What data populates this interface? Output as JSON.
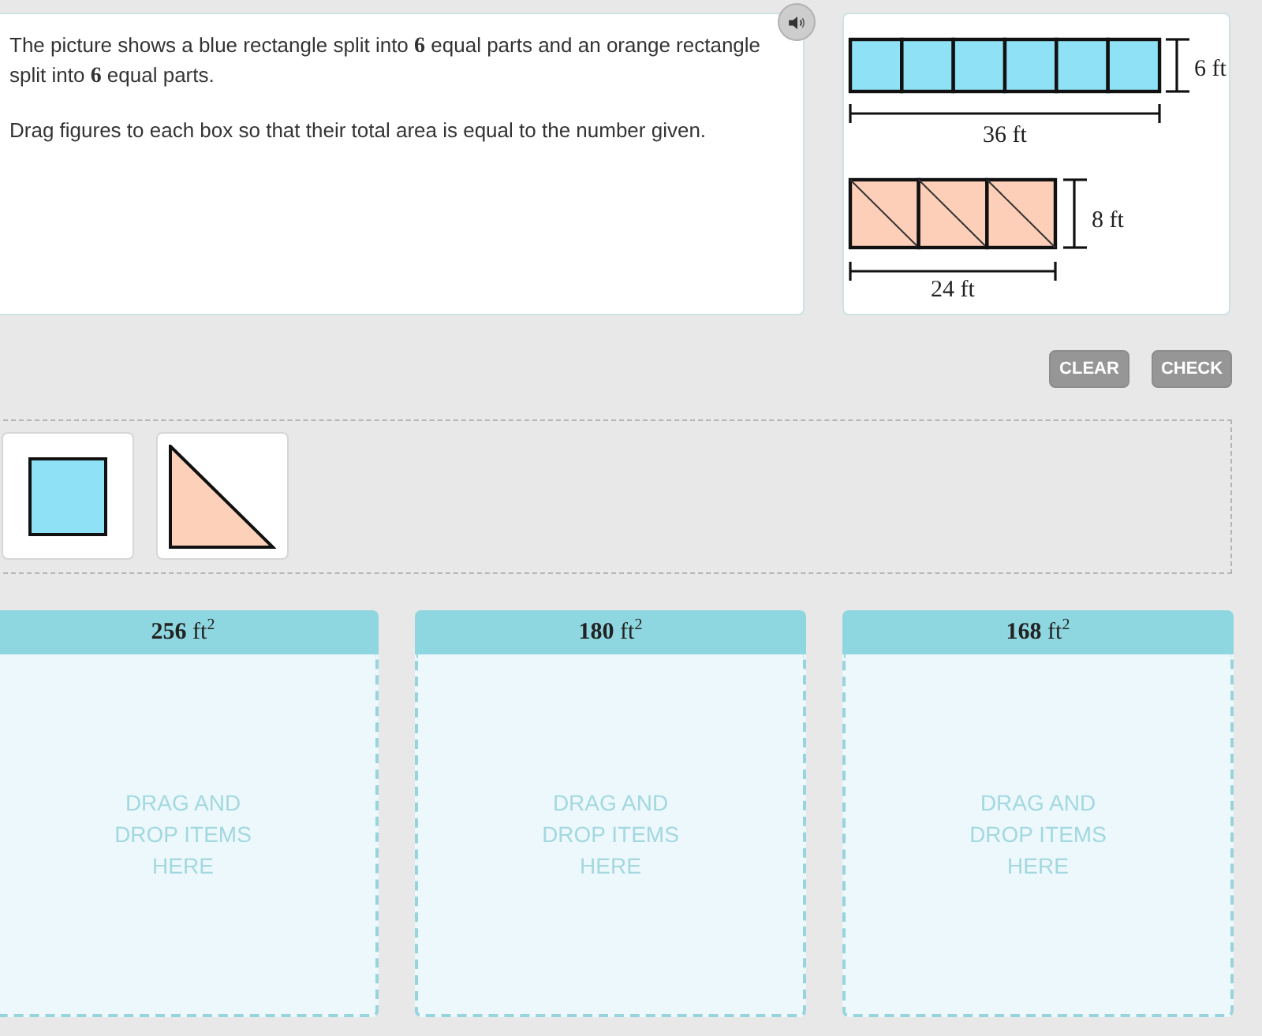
{
  "question": {
    "paragraphs": [
      "The picture shows a blue rectangle split into **6** equal parts and an orange rectangle split into **6** equal parts.",
      "Drag figures to each box so that their total area is equal to the number given."
    ]
  },
  "figure": {
    "blue_rectangle": {
      "height_label": "6 ft",
      "width_label": "36 ft"
    },
    "orange_rectangle": {
      "height_label": "8 ft",
      "width_label": "24 ft"
    }
  },
  "buttons": [
    {
      "label": "CLEAR",
      "disabled": true
    },
    {
      "label": "CHECK",
      "disabled": true
    }
  ],
  "tray": {
    "items": [
      {
        "kind": "square"
      },
      {
        "kind": "triangle"
      }
    ]
  },
  "drop_boxes": [
    {
      "heading": "**256** ft$^{2}$",
      "placeholder": "DRAG AND DROP ITEMS HERE"
    },
    {
      "heading": "**180** ft$^{2}$",
      "placeholder": "DRAG AND DROP ITEMS HERE"
    },
    {
      "heading": "**168** ft$^{2}$",
      "placeholder": "DRAG AND DROP ITEMS HERE"
    }
  ]
}
